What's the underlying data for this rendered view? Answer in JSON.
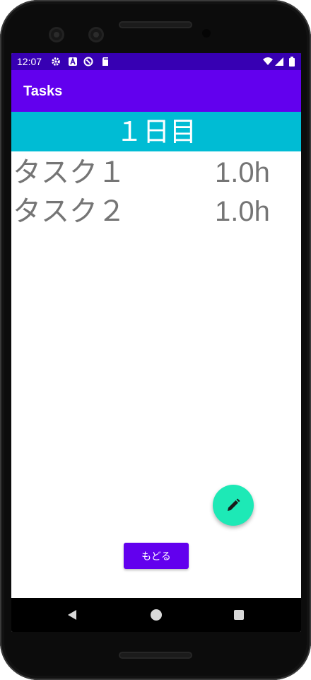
{
  "status": {
    "time": "12:07"
  },
  "app": {
    "title": "Tasks"
  },
  "day": {
    "title": "１日目"
  },
  "tasks": [
    {
      "name": "タスク１",
      "hours": "1.0h"
    },
    {
      "name": "タスク２",
      "hours": "1.0h"
    }
  ],
  "buttons": {
    "back_label": "もどる"
  },
  "colors": {
    "status_bar": "#3700b3",
    "app_bar": "#6200ee",
    "day_header": "#00bcd4",
    "fab": "#1de9b6",
    "task_text": "#757575"
  },
  "icons": {
    "fab": "pencil-icon",
    "status": [
      "settings-icon",
      "a-icon",
      "sync-icon",
      "sd-card-icon",
      "wifi-icon",
      "signal-icon",
      "battery-icon"
    ],
    "nav": [
      "nav-back-icon",
      "nav-home-icon",
      "nav-recent-icon"
    ]
  }
}
